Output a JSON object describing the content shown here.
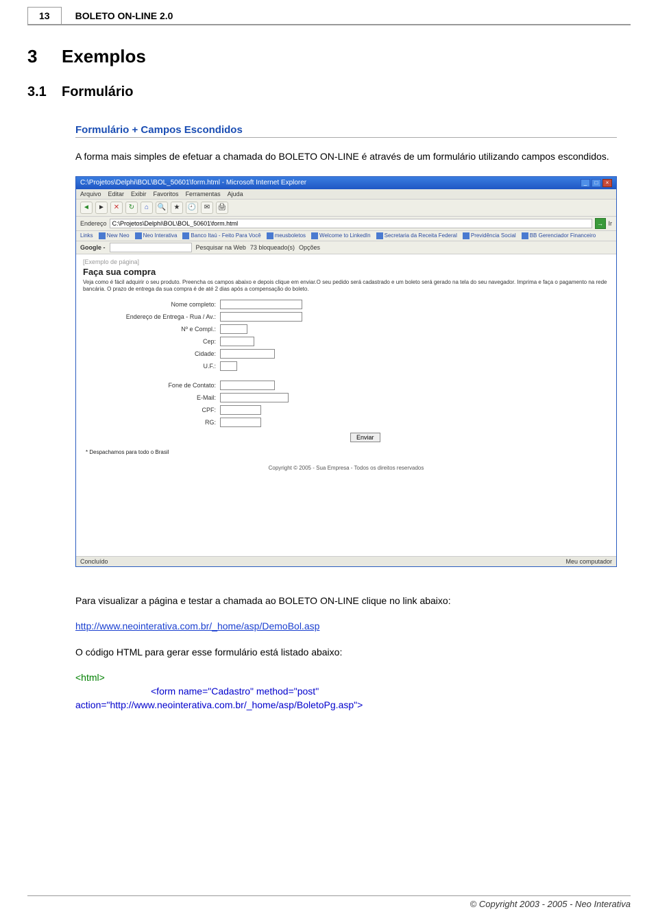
{
  "header": {
    "page_number": "13",
    "doc_title": "BOLETO ON-LINE 2.0"
  },
  "chapter": {
    "num": "3",
    "title": "Exemplos"
  },
  "section": {
    "num": "3.1",
    "title": "Formulário"
  },
  "subhead": "Formulário + Campos Escondidos",
  "intro": "A forma mais simples de efetuar a chamada do BOLETO ON-LINE é através de um formulário utilizando campos escondidos.",
  "browser": {
    "title": "C:\\Projetos\\Delphi\\BOL\\BOL_50601\\form.html - Microsoft Internet Explorer",
    "menus": [
      "Arquivo",
      "Editar",
      "Exibir",
      "Favoritos",
      "Ferramentas",
      "Ajuda"
    ],
    "addr_label": "Endereço",
    "addr_value": "C:\\Projetos\\Delphi\\BOL\\BOL_50601\\form.html",
    "go_label": "Ir",
    "links_label": "Links",
    "links": [
      "New Neo",
      "Neo Interativa",
      "Banco Itaú - Feito Para Você",
      "meusboletos",
      "Welcome to LinkedIn",
      "Secretaria da Receita Federal",
      "Previdência Social",
      "BB Gerenciador Financeiro"
    ],
    "google_label": "Google -",
    "google_search": "Pesquisar na Web",
    "google_blocked": "73 bloqueado(s)",
    "google_options": "Opções",
    "example_tag": "[Exemplo de página]",
    "page_heading": "Faça sua compra",
    "page_desc": "Veja como é fácil adquirir o seu produto. Preencha os campos abaixo e depois clique em enviar.O seu pedido será cadastrado e um boleto será gerado na tela do seu navegador. Imprima e faça o pagamento na rede bancária. O prazo de entrega da sua compra é de até 2 dias após a compensação do boleto.",
    "fields": {
      "nome": "Nome completo:",
      "endereco": "Endereço de Entrega - Rua / Av.:",
      "numero": "Nº e Compl.:",
      "cep": "Cep:",
      "cidade": "Cidade:",
      "uf": "U.F.:",
      "fone": "Fone de Contato:",
      "email": "E-Mail:",
      "cpf": "CPF:",
      "rg": "RG:"
    },
    "submit": "Enviar",
    "shipping_note": "* Despachamos para todo o Brasil",
    "copyright": "Copyright © 2005 - Sua Empresa - Todos os direitos reservados",
    "status_left": "Concluído",
    "status_right": "Meu computador"
  },
  "after1": "Para visualizar a página e testar a chamada ao BOLETO ON-LINE clique no link abaixo:",
  "link_url": "http://www.neointerativa.com.br/_home/asp/DemoBol.asp",
  "after2": "O código HTML para gerar esse formulário está listado abaixo:",
  "code": {
    "l1": "<html>",
    "l2": "<form name=\"Cadastro\" method=\"post\"",
    "l3": "action=\"http://www.neointerativa.com.br/_home/asp/BoletoPg.asp\">"
  },
  "footer": "© Copyright 2003 - 2005 - Neo Interativa"
}
